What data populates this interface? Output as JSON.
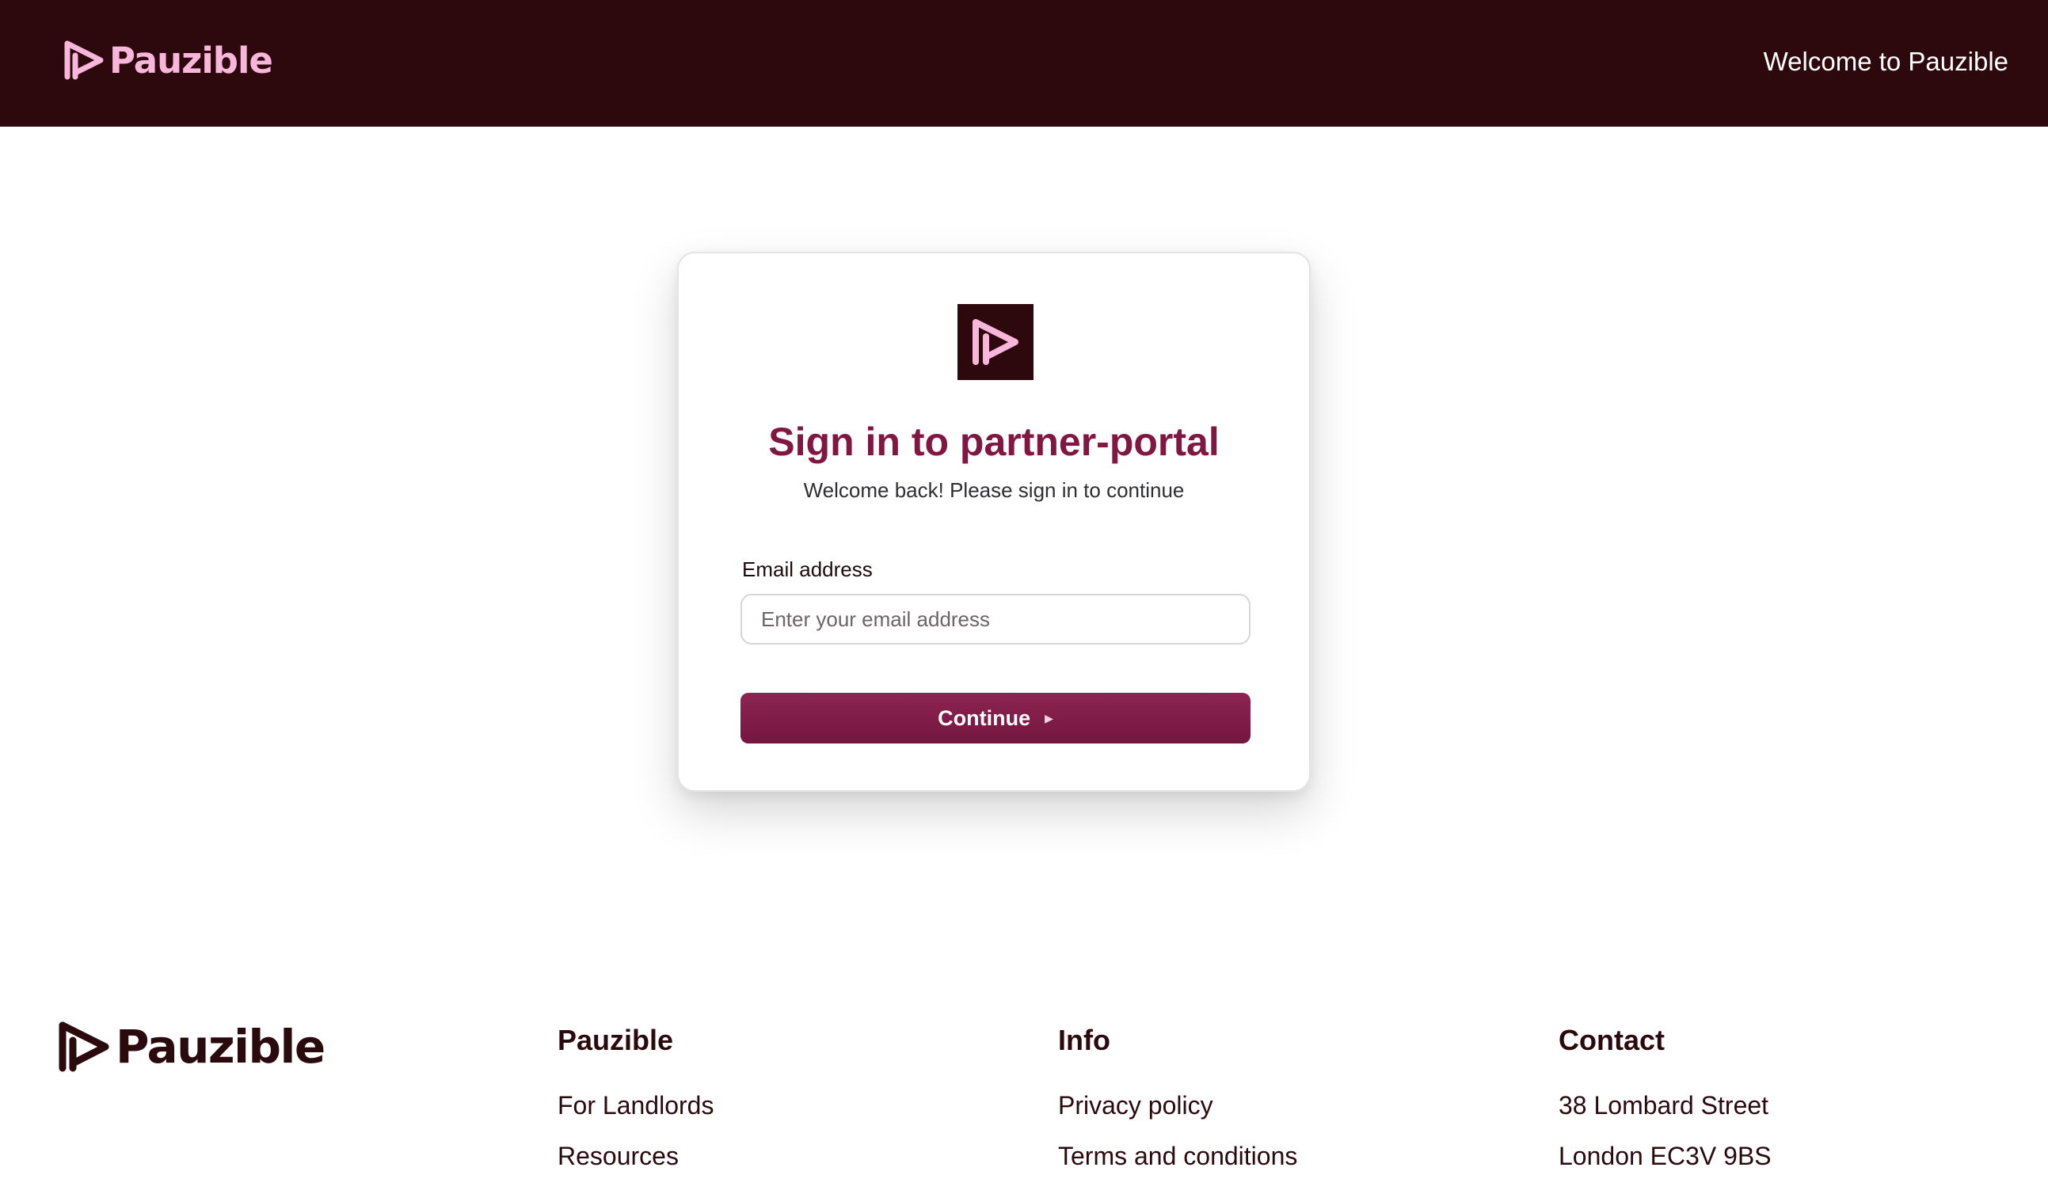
{
  "header": {
    "brand_name": "Pauzible",
    "welcome_text": "Welcome to Pauzible",
    "logo_icon": "pauzible-play-icon"
  },
  "card": {
    "title": "Sign in to partner-portal",
    "subtitle": "Welcome back! Please sign in to continue",
    "email_label": "Email address",
    "email_value": "",
    "email_placeholder": "Enter your email address",
    "continue_label": "Continue",
    "continue_icon": "caret-right-icon"
  },
  "footer": {
    "brand_name": "Pauzible",
    "columns": [
      {
        "heading": "Pauzible",
        "items": [
          "For Landlords",
          "Resources"
        ]
      },
      {
        "heading": "Info",
        "items": [
          "Privacy policy",
          "Terms and conditions"
        ]
      },
      {
        "heading": "Contact",
        "items": [
          "38 Lombard Street",
          "London EC3V 9BS"
        ]
      }
    ]
  },
  "colors": {
    "header_bg": "#2d080d",
    "brand_pink": "#f7b6da",
    "accent": "#801641",
    "button": "#7d1a48",
    "text_dark": "#2b0a0d"
  }
}
